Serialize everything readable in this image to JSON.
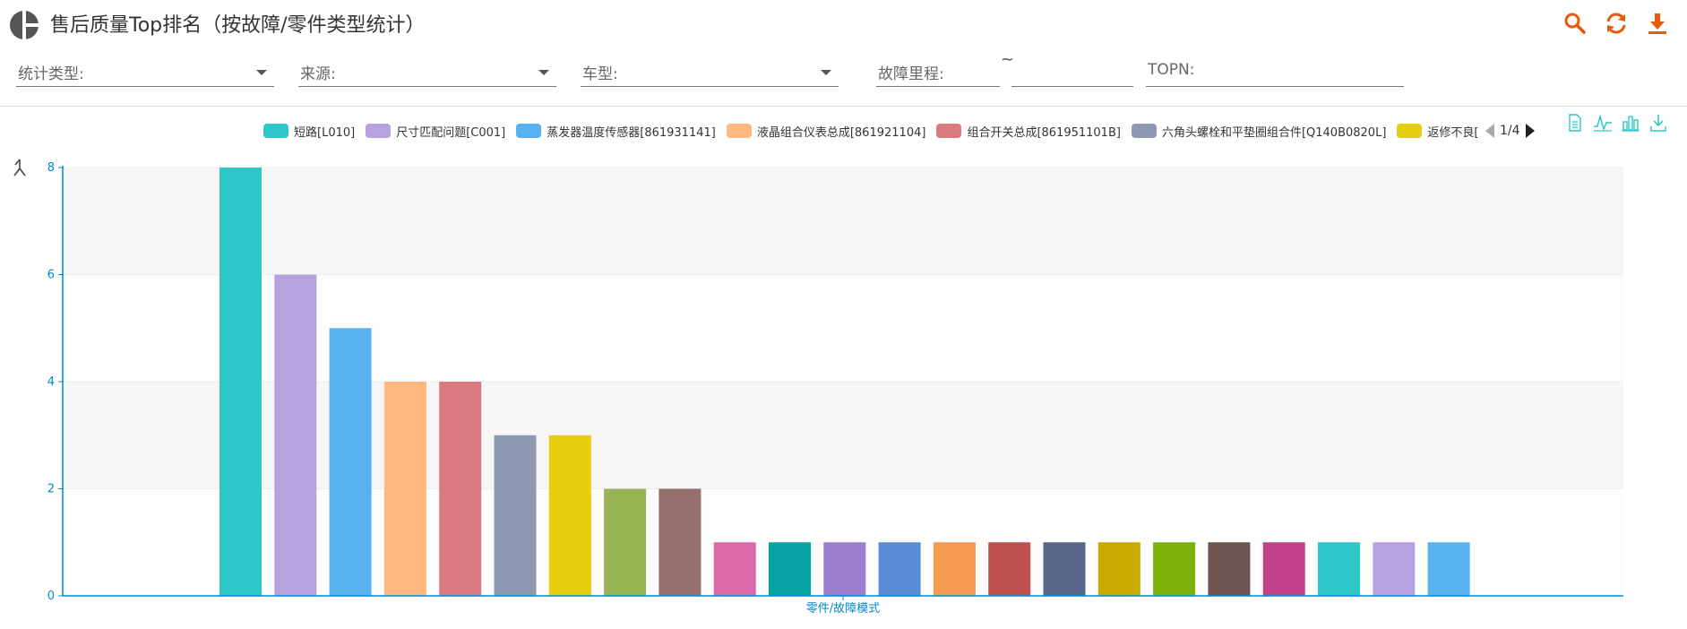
{
  "header": {
    "title": "售后质量Top排名（按故障/零件类型统计）",
    "icons": [
      "pie-logo-icon",
      "search-icon",
      "refresh-icon",
      "download-icon"
    ]
  },
  "filters": {
    "stat_type_label": "统计类型:",
    "source_label": "来源:",
    "vehicle_label": "车型:",
    "mileage_label": "故障里程:",
    "range_separator": "~",
    "topn_label": "TOPN:"
  },
  "legend": {
    "items": [
      {
        "label": "短路[L010]",
        "color": "#2ec7c9"
      },
      {
        "label": "尺寸匹配问题[C001]",
        "color": "#b6a2de"
      },
      {
        "label": "蒸发器温度传感器[861931141]",
        "color": "#5ab1ef"
      },
      {
        "label": "液晶组合仪表总成[861921104]",
        "color": "#ffb980"
      },
      {
        "label": "组合开关总成[861951101B]",
        "color": "#d87a80"
      },
      {
        "label": "六角头螺栓和平垫圈组合件[Q140B0820L]",
        "color": "#8d98b3"
      },
      {
        "label": "返修不良[",
        "color": "#e5cf0d"
      }
    ],
    "page": "1/4"
  },
  "toolbox": [
    "data-view-icon",
    "line-chart-icon",
    "bar-chart-icon",
    "save-image-icon"
  ],
  "colors": {
    "accent": "#e8590c",
    "axis": "#008acd",
    "toolbox": "#2ec7c9"
  },
  "chart_data": {
    "type": "bar",
    "xlabel": "零件/故障模式",
    "ylabel": "",
    "ylim": [
      0,
      8
    ],
    "yticks": [
      0,
      2,
      4,
      6,
      8
    ],
    "values": [
      8,
      6,
      5,
      4,
      4,
      3,
      3,
      2,
      2,
      1,
      1,
      1,
      1,
      1,
      1,
      1,
      1,
      1,
      1,
      1,
      1,
      1,
      1
    ],
    "colors": [
      "#2ec7c9",
      "#b6a2de",
      "#5ab1ef",
      "#ffb980",
      "#d87a80",
      "#8d98b3",
      "#e5cf0d",
      "#97b552",
      "#95706d",
      "#dc69aa",
      "#07a2a4",
      "#9a7fd1",
      "#588dd5",
      "#f5994e",
      "#c05050",
      "#59678c",
      "#c9ab00",
      "#7eb00a",
      "#6f5553",
      "#c14089",
      "#2ec7c9",
      "#b6a2de",
      "#5ab1ef"
    ],
    "grid": "alternating-bands",
    "legend_position": "top"
  }
}
